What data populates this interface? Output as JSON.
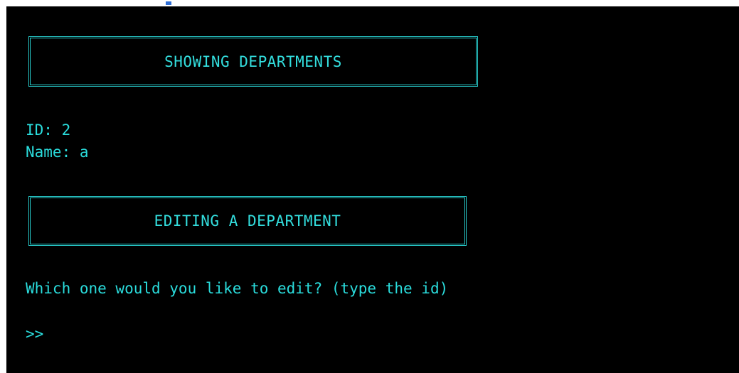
{
  "console": {
    "banner_showing": "SHOWING DEPARTMENTS",
    "department": {
      "id_label": "ID:",
      "id_value": "2",
      "name_label": "Name:",
      "name_value": "a"
    },
    "banner_editing": "EDITING A DEPARTMENT",
    "question": "Which one would you like to edit? (type the id)",
    "prompt": ">>"
  },
  "colors": {
    "background": "#000000",
    "foreground": "#22d6d6",
    "border": "#27c8c8"
  }
}
